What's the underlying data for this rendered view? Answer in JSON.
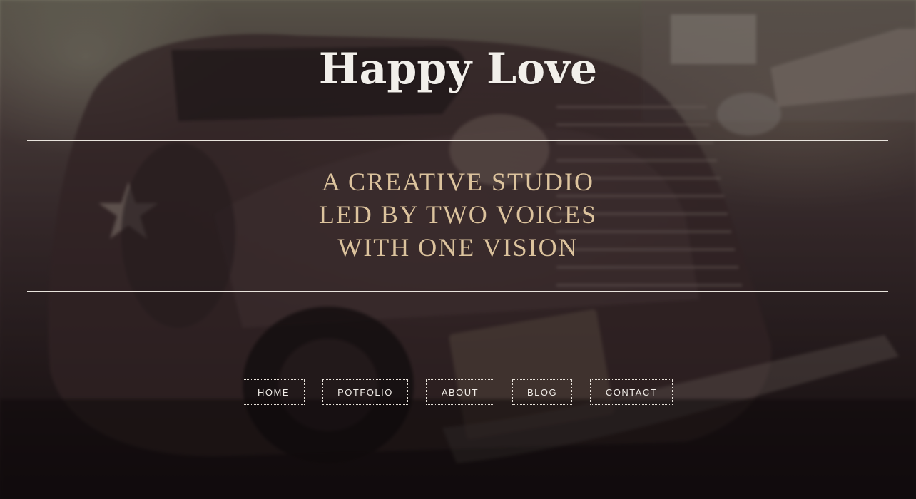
{
  "site": {
    "title": "Happy Love"
  },
  "tagline": {
    "line1": "A CREATIVE STUDIO",
    "line2": "LED BY TWO VOICES",
    "line3": "WITH ONE VISION"
  },
  "nav": {
    "items": [
      {
        "label": "HOME"
      },
      {
        "label": "POTFOLIO"
      },
      {
        "label": "ABOUT"
      },
      {
        "label": "BLOG"
      },
      {
        "label": "CONTACT"
      }
    ]
  },
  "colors": {
    "title": "#f2efea",
    "tagline": "#dcc39d",
    "rule": "#e9e4dd",
    "nav_border": "#e8e2da"
  }
}
